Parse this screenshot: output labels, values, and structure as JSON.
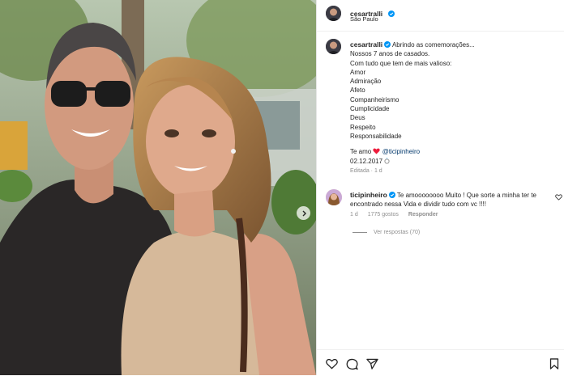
{
  "post": {
    "author": "cesartralli",
    "location": "São Paulo",
    "caption_lines": [
      "Abrindo as comemorações...",
      "Nossos 7 anos de casados.",
      "Com tudo que tem de mais valioso:",
      "Amor",
      "Admiração",
      "Afeto",
      "Companheirismo",
      "Cumplicidade",
      "Deus",
      "Respeito",
      "Responsabilidade"
    ],
    "te_amo": "Te amo",
    "mention": "@ticipinheiro",
    "date": "02.12.2017",
    "edited": "Editada · 1 d"
  },
  "comment": {
    "author": "ticipinheiro",
    "text": "Te amoooooooo Muito ! Que sorte a minha ter te encontrado nessa Vida e dividir tudo com vc !!!!",
    "age": "1 d",
    "likes": "1775 gostos",
    "reply": "Responder",
    "view_replies": "Ver respostas (70)"
  },
  "icons": {
    "verified": "verified-badge-icon",
    "heart": "heart-icon",
    "comment": "comment-icon",
    "share": "share-icon",
    "save": "bookmark-icon",
    "emoji_heart": "red-heart-emoji",
    "ring": "ring-emoji"
  },
  "colors": {
    "verified": "#0095f6",
    "mention": "#00376b",
    "muted": "#8e8e8e",
    "emoji_heart": "#ed1c3c"
  }
}
